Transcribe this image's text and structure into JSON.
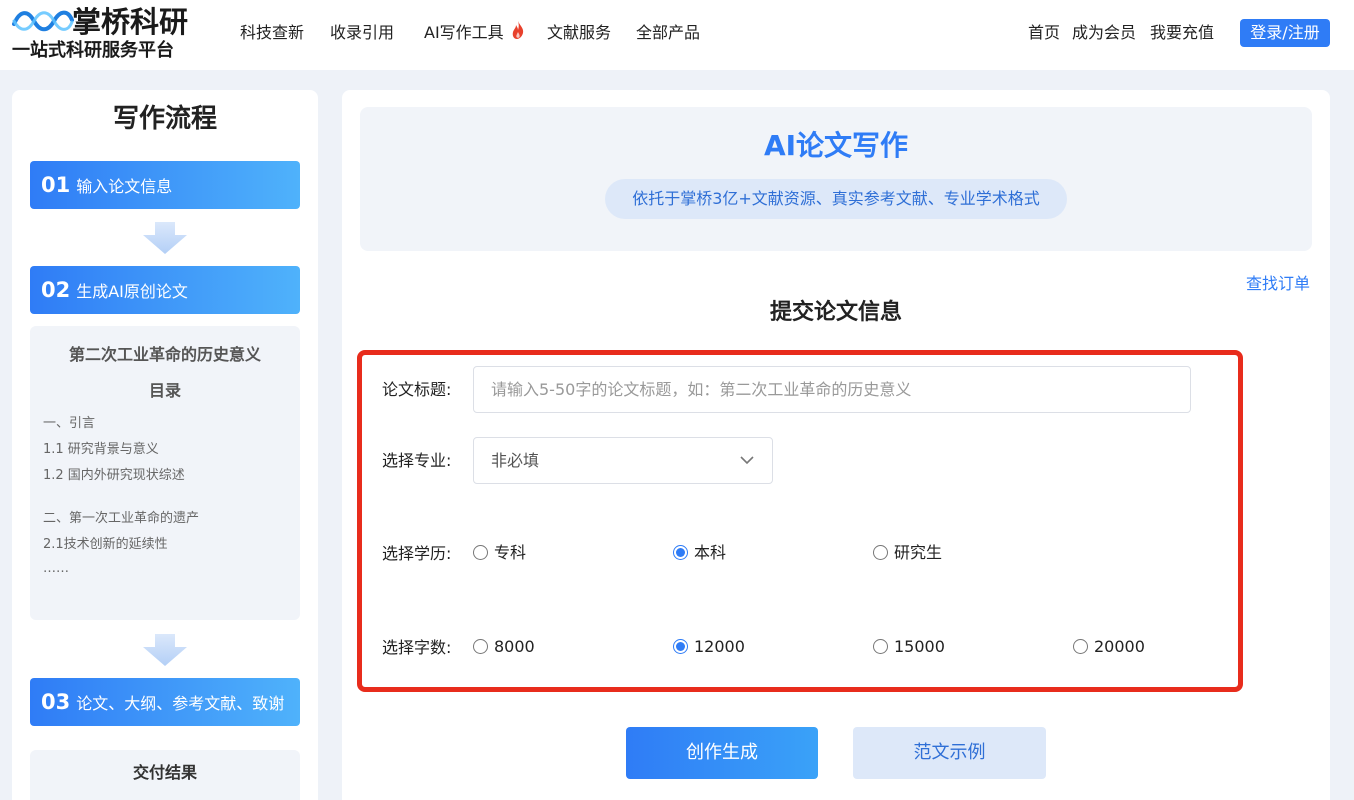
{
  "header": {
    "logo_name": "掌桥科研",
    "logo_slogan": "一站式科研服务平台",
    "nav": [
      {
        "label": "科技查新"
      },
      {
        "label": "收录引用"
      },
      {
        "label": "AI写作工具",
        "icon": "flame-icon"
      },
      {
        "label": "文献服务"
      },
      {
        "label": "全部产品"
      }
    ],
    "links": [
      "首页",
      "成为会员",
      "我要充值"
    ],
    "login_label": "登录/注册"
  },
  "process": {
    "title": "写作流程",
    "steps": [
      {
        "num": "01",
        "label": "输入论文信息"
      },
      {
        "num": "02",
        "label": "生成AI原创论文"
      },
      {
        "num": "03",
        "label": "论文、大纲、参考文献、致谢"
      }
    ],
    "preview": {
      "title": "第二次工业革命的历史意义",
      "subtitle": "目录",
      "toc": [
        "一、引言",
        "1.1 研究背景与意义",
        "1.2 国内外研究现状综述",
        "二、第一次工业革命的遗产",
        "2.1技术创新的延续性",
        "……"
      ]
    },
    "result_title": "交付结果"
  },
  "main": {
    "banner_title": "AI论文写作",
    "banner_subtitle": "依托于掌桥3亿+文献资源、真实参考文献、专业学术格式",
    "find_order": "查找订单",
    "form_title": "提交论文信息",
    "form": {
      "title_label": "论文标题:",
      "title_placeholder": "请输入5-50字的论文标题，如：第二次工业革命的历史意义",
      "major_label": "选择专业:",
      "major_value": "非必填",
      "degree_label": "选择学历:",
      "degree_options": [
        {
          "label": "专科",
          "checked": false
        },
        {
          "label": "本科",
          "checked": true
        },
        {
          "label": "研究生",
          "checked": false
        }
      ],
      "words_label": "选择字数:",
      "words_options": [
        {
          "label": "8000",
          "checked": false
        },
        {
          "label": "12000",
          "checked": true
        },
        {
          "label": "15000",
          "checked": false
        },
        {
          "label": "20000",
          "checked": false
        }
      ]
    },
    "create_label": "创作生成",
    "sample_label": "范文示例"
  },
  "colors": {
    "accent": "#2f7cf6",
    "highlight_border": "#e82c1c",
    "flame": "#e8412c"
  }
}
